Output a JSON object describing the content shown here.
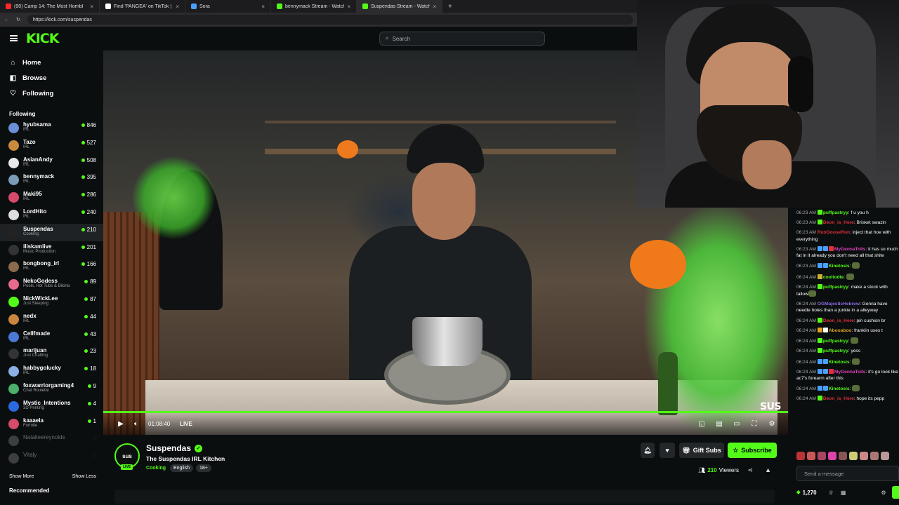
{
  "browser": {
    "tabs": [
      {
        "label": "(90) Camp 14: The Most Horribl",
        "color": "#ff2a2a",
        "active": false
      },
      {
        "label": "Find 'PANGEA' on TikTok | TikTok",
        "color": "#ffffff",
        "active": false
      },
      {
        "label": "Sora",
        "color": "#4aa0ff",
        "active": false
      },
      {
        "label": "bennymack Stream - Watch Live o",
        "color": "#53fc18",
        "active": false
      },
      {
        "label": "Suspendas Stream - Watch Live o",
        "color": "#53fc18",
        "active": true
      }
    ],
    "new_tab": "+",
    "url": "https://kick.com/suspendas"
  },
  "header": {
    "logo": "KICK",
    "search_placeholder": "Search"
  },
  "sidebar": {
    "nav": [
      {
        "label": "Home",
        "icon": "home-icon",
        "glyph": "⌂"
      },
      {
        "label": "Browse",
        "icon": "browse-icon",
        "glyph": "◧"
      },
      {
        "label": "Following",
        "icon": "heart-icon",
        "glyph": "♡"
      }
    ],
    "following_title": "Following",
    "channels": [
      {
        "name": "hyubsama",
        "category": "IRL",
        "viewers": "846",
        "color": "#6a8fd6"
      },
      {
        "name": "Tazo",
        "category": "IRL",
        "viewers": "527",
        "color": "#c98a3e"
      },
      {
        "name": "AsianAndy",
        "category": "IRL",
        "viewers": "508",
        "color": "#e8e8e8"
      },
      {
        "name": "bennymack",
        "category": "IRL",
        "viewers": "395",
        "color": "#7d9bb8"
      },
      {
        "name": "Maki95",
        "category": "IRL",
        "viewers": "286",
        "color": "#d64a6a"
      },
      {
        "name": "LordHito",
        "category": "IRL",
        "viewers": "240",
        "color": "#ddd"
      },
      {
        "name": "Suspendas",
        "category": "Cooking",
        "viewers": "210",
        "color": "#222"
      },
      {
        "name": "iliskamlive",
        "category": "Music Production",
        "viewers": "201",
        "color": "#333"
      },
      {
        "name": "bongbong_irl",
        "category": "IRL",
        "viewers": "166",
        "color": "#8a6a4a"
      },
      {
        "name": "NekoGodess",
        "category": "Pools, Hot Tubs & Bikinis",
        "viewers": "89",
        "color": "#e86a8a"
      },
      {
        "name": "NickWickLee",
        "category": "Just Sleeping",
        "viewers": "87",
        "color": "#53fc18"
      },
      {
        "name": "nedx",
        "category": "IRL",
        "viewers": "44",
        "color": "#c9863e"
      },
      {
        "name": "Cellfmade",
        "category": "IRL",
        "viewers": "43",
        "color": "#4a7ad6"
      },
      {
        "name": "marijuan",
        "category": "Just Chatting",
        "viewers": "23",
        "color": "#333"
      },
      {
        "name": "habbygolucky",
        "category": "IRL",
        "viewers": "18",
        "color": "#8ab0e6"
      },
      {
        "name": "foxwarriorgaming4",
        "category": "Chat Roulette",
        "viewers": "9",
        "color": "#4ab06a"
      },
      {
        "name": "Mystic_Intentions",
        "category": "3D Printing",
        "viewers": "4",
        "color": "#2a6ae0"
      },
      {
        "name": "kaaaela",
        "category": "Fortnite",
        "viewers": "1",
        "color": "#d64a6a"
      },
      {
        "name": "Natalieereynolds",
        "category": "",
        "viewers": "",
        "color": "#888"
      },
      {
        "name": "Vitaly",
        "category": "",
        "viewers": "",
        "color": "#888"
      }
    ],
    "show_more": "Show More",
    "show_less": "Show Less",
    "recommended": "Recommended"
  },
  "player": {
    "time": "01:08:40",
    "live_label": "LIVE",
    "watermark": "SUS"
  },
  "channel": {
    "avatar_text": "sus",
    "live_badge": "LIVE",
    "name": "Suspendas",
    "title": "The Suspendas IRL Kitchen",
    "category": "Cooking",
    "tags": [
      "English",
      "18+"
    ],
    "gift_subs": "Gift Subs",
    "subscribe": "Subscribe",
    "viewers": "210",
    "viewers_label": "Viewers"
  },
  "chat": {
    "messages": [
      {
        "time": "06:23 AM",
        "user": "puffpastryy",
        "color": "#53fc18",
        "text": "f u you h",
        "badges": [
          "#53fc18"
        ]
      },
      {
        "time": "06:23 AM",
        "user": "Deon_is_Here",
        "color": "#e0303a",
        "text": "Brisket swazin",
        "badges": [
          "#53fc18"
        ]
      },
      {
        "time": "06:23 AM",
        "user": "RunGooseRun",
        "color": "#e0303a",
        "text": "inject that hoe with everything",
        "badges": []
      },
      {
        "time": "06:23 AM",
        "user": "MyGennaTolls",
        "color": "#e040c0",
        "text": "it has so much fat in it already you don't need all that shite",
        "badges": [
          "#4aa0ff",
          "#4aa0ff",
          "#e0303a"
        ]
      },
      {
        "time": "06:23 AM",
        "user": "Kinetosis",
        "color": "#53fc18",
        "text": "",
        "badges": [
          "#4aa0ff",
          "#4aa0ff"
        ],
        "emote": true
      },
      {
        "time": "06:24 AM",
        "user": "cooltodie",
        "color": "#53fc18",
        "text": "",
        "badges": [
          "#d0b030"
        ],
        "emote": true
      },
      {
        "time": "06:24 AM",
        "user": "puffpastryy",
        "color": "#53fc18",
        "text": "make a stock with tallow",
        "badges": [
          "#53fc18"
        ],
        "emote": true
      },
      {
        "time": "06:24 AM",
        "user": "OGMajesticHebrew",
        "color": "#8a6ae0",
        "text": "Gonna have needle holes than a junkie in a alleyway",
        "badges": []
      },
      {
        "time": "06:24 AM",
        "user": "Deon_is_Here",
        "color": "#e0303a",
        "text": "pin cushion br",
        "badges": [
          "#53fc18"
        ]
      },
      {
        "time": "06:24 AM",
        "user": "Abooaboo",
        "color": "#e0a020",
        "text": "franklin uses t",
        "badges": [
          "#e0a020",
          "#ffffff"
        ]
      },
      {
        "time": "06:24 AM",
        "user": "puffpastryy",
        "color": "#53fc18",
        "text": "",
        "badges": [
          "#53fc18"
        ],
        "emote": true
      },
      {
        "time": "06:24 AM",
        "user": "puffpastryy",
        "color": "#53fc18",
        "text": "yess",
        "badges": [
          "#53fc18"
        ]
      },
      {
        "time": "06:24 AM",
        "user": "Kinetosis",
        "color": "#53fc18",
        "text": "",
        "badges": [
          "#4aa0ff",
          "#4aa0ff"
        ],
        "emote": true
      },
      {
        "time": "06:24 AM",
        "user": "MyGennaTolls",
        "color": "#e040c0",
        "text": "it's go look like ac7's forearm after this",
        "badges": [
          "#4aa0ff",
          "#4aa0ff",
          "#e0303a"
        ]
      },
      {
        "time": "06:24 AM",
        "user": "Kinetosis",
        "color": "#53fc18",
        "text": "",
        "badges": [
          "#4aa0ff",
          "#4aa0ff"
        ],
        "emote": true
      },
      {
        "time": "06:24 AM",
        "user": "Deon_is_Here",
        "color": "#e0303a",
        "text": "hope its pepp",
        "badges": [
          "#53fc18"
        ]
      }
    ],
    "send_placeholder": "Send a message",
    "points": "1,270"
  },
  "colors": {
    "accent": "#53fc18",
    "bg": "#0b0e0f"
  }
}
